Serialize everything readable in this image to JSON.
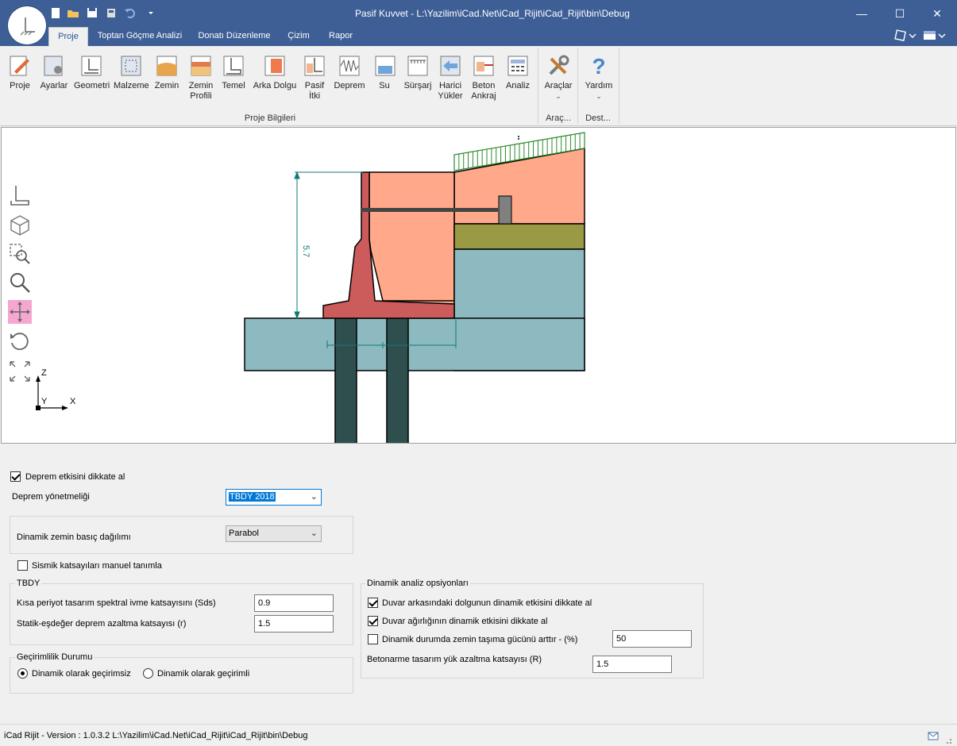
{
  "app": {
    "title": "Pasif Kuvvet - L:\\Yazilim\\iCad.Net\\iCad_Rijit\\iCad_Rijit\\bin\\Debug",
    "minimize": "—",
    "maximize": "☐",
    "close": "✕"
  },
  "tabs": [
    "Proje",
    "Toptan Göçme Analizi",
    "Donatı Düzenleme",
    "Çizim",
    "Rapor"
  ],
  "ribbon": {
    "buttons": [
      {
        "l1": "Proje",
        "l2": ""
      },
      {
        "l1": "Ayarlar",
        "l2": ""
      },
      {
        "l1": "Geometri",
        "l2": ""
      },
      {
        "l1": "Malzeme",
        "l2": ""
      },
      {
        "l1": "Zemin",
        "l2": ""
      },
      {
        "l1": "Zemin",
        "l2": "Profili"
      },
      {
        "l1": "Temel",
        "l2": ""
      },
      {
        "l1": "Arka Dolgu",
        "l2": ""
      },
      {
        "l1": "Pasif",
        "l2": "İtki"
      },
      {
        "l1": "Deprem",
        "l2": ""
      },
      {
        "l1": "Su",
        "l2": ""
      },
      {
        "l1": "Sürşarj",
        "l2": ""
      },
      {
        "l1": "Harici",
        "l2": "Yükler"
      },
      {
        "l1": "Beton",
        "l2": "Ankraj"
      },
      {
        "l1": "Analiz",
        "l2": ""
      }
    ],
    "tools_label": "Araçlar",
    "help_label": "Yardım",
    "group_proje": "Proje Bilgileri",
    "group_araclar": "Araç...",
    "group_destek": "Dest..."
  },
  "drawing": {
    "dimension_label": "5.7",
    "axis_z": "Z",
    "axis_y": "Y",
    "axis_x": "X",
    "colors": {
      "soil_backfill": "#ffa98a",
      "wall": "#cc5b5b",
      "foundation_soil": "#8cbac0",
      "olive_layer": "#9a9a45",
      "pile": "#2f4e4e",
      "surcharge": "#2c8a2c",
      "dimension": "#117a78"
    }
  },
  "form": {
    "deprem_checkbox": {
      "label": "Deprem etkisini dikkate al",
      "checked": true
    },
    "yonetmelik": {
      "label": "Deprem yönetmeliği",
      "value": "TBDY 2018"
    },
    "dagilim": {
      "label": "Dinamik zemin basıç dağılımı",
      "value": "Parabol"
    },
    "manuel_checkbox": {
      "label": "Sismik katsayıları manuel tanımla",
      "checked": false
    },
    "tbdy_group": "TBDY",
    "sds": {
      "label": "Kısa periyot tasarım spektral ivme katsayısını (Sds)",
      "value": "0.9"
    },
    "r": {
      "label": "Statik-eşdeğer deprem azaltma katsayısı (r)",
      "value": "1.5"
    },
    "gecirimlilik_group": "Geçirimlilik Durumu",
    "gecirimsiz": {
      "label": "Dinamik olarak geçirimsiz",
      "selected": true
    },
    "gecirimli": {
      "label": "Dinamik olarak geçirimli",
      "selected": false
    },
    "dinamik_group": "Dinamik analiz opsiyonları",
    "opt1": {
      "label": "Duvar arkasındaki dolgunun dinamik etkisini dikkate al",
      "checked": true
    },
    "opt2": {
      "label": "Duvar ağırlığının dinamik etkisini dikkate al",
      "checked": true
    },
    "opt3": {
      "label": "Dinamik durumda zemin taşıma gücünü arttır - (%)",
      "checked": false,
      "value": "50"
    },
    "R": {
      "label": "Betonarme tasarım yük azaltma katsayısı (R)",
      "value": "1.5"
    }
  },
  "status": {
    "text": "iCad Rijit - Version : 1.0.3.2   L:\\Yazilim\\iCad.Net\\iCad_Rijit\\iCad_Rijit\\bin\\Debug"
  }
}
